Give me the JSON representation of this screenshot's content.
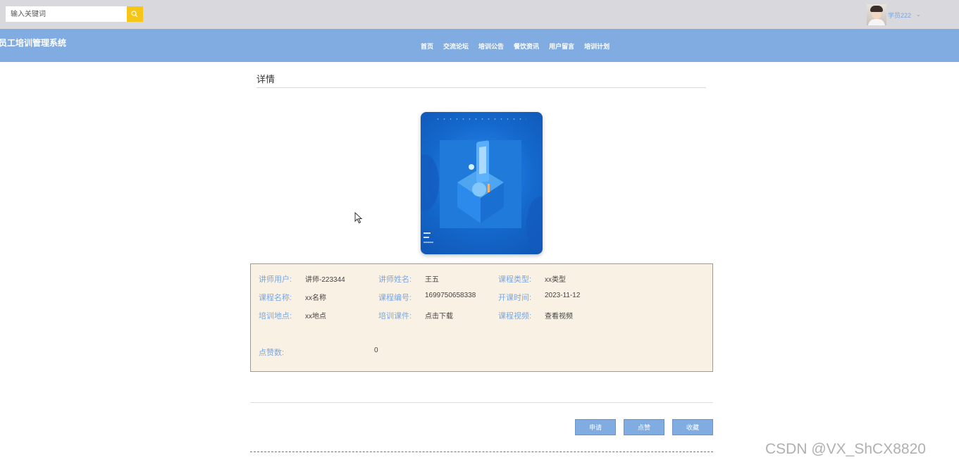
{
  "search": {
    "placeholder": "输入关键词"
  },
  "user": {
    "name": "学员222",
    "caret": "⌄"
  },
  "site": {
    "title": "员工培训管理系统"
  },
  "nav": [
    "首页",
    "交流论坛",
    "培训公告",
    "餐饮资讯",
    "用户留言",
    "培训计划"
  ],
  "page": {
    "title": "详情"
  },
  "details": {
    "trainer_user_label": "讲师用户:",
    "trainer_user": "讲师-223344",
    "trainer_name_label": "讲师姓名:",
    "trainer_name": "王五",
    "course_type_label": "课程类型:",
    "course_type": "xx类型",
    "course_name_label": "课程名称:",
    "course_name": "xx名称",
    "course_code_label": "课程编号:",
    "course_code": "1699750658338",
    "start_time_label": "开课时间:",
    "start_time": "2023-11-12",
    "location_label": "培训地点:",
    "location": "xx地点",
    "courseware_label": "培训课件:",
    "courseware": "点击下载",
    "video_label": "课程视频:",
    "video": "查看视频",
    "likes_label": "点赞数:",
    "likes": "0"
  },
  "actions": {
    "apply": "申请",
    "like": "点赞",
    "favorite": "收藏"
  },
  "watermark": "CSDN @VX_ShCX8820",
  "colors": {
    "nav_bg": "#81ace2",
    "search_btn": "#f5c518",
    "label": "#7aa7de",
    "info_bg": "#faf1e5"
  }
}
